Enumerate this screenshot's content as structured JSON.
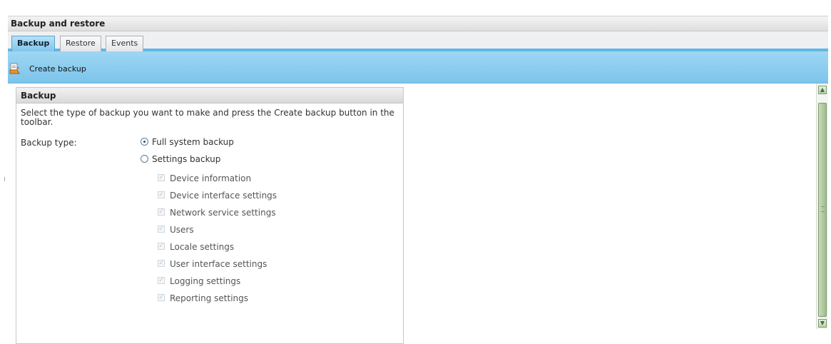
{
  "window": {
    "title": "Backup and restore"
  },
  "tabs": [
    {
      "label": "Backup",
      "active": true
    },
    {
      "label": "Restore",
      "active": false
    },
    {
      "label": "Events",
      "active": false
    }
  ],
  "toolbar": {
    "create_backup_label": "Create backup",
    "icon": "create-backup-icon"
  },
  "panel": {
    "title": "Backup",
    "description": "Select the type of backup you want to make and press the Create backup button in the toolbar.",
    "backup_type_label": "Backup type:",
    "radios": [
      {
        "label": "Full system backup",
        "checked": true
      },
      {
        "label": "Settings backup",
        "checked": false
      }
    ],
    "checkboxes": [
      {
        "label": "Device information",
        "checked": true,
        "disabled": true
      },
      {
        "label": "Device interface settings",
        "checked": true,
        "disabled": true
      },
      {
        "label": "Network service settings",
        "checked": true,
        "disabled": true
      },
      {
        "label": "Users",
        "checked": true,
        "disabled": true
      },
      {
        "label": "Locale settings",
        "checked": true,
        "disabled": true
      },
      {
        "label": "User interface settings",
        "checked": true,
        "disabled": true
      },
      {
        "label": "Logging settings",
        "checked": true,
        "disabled": true
      },
      {
        "label": "Reporting settings",
        "checked": true,
        "disabled": true
      }
    ]
  },
  "colors": {
    "accent": "#7cc4ec",
    "tab_active": "#9fd6f3",
    "scrollbar": "#9ebd8b"
  }
}
